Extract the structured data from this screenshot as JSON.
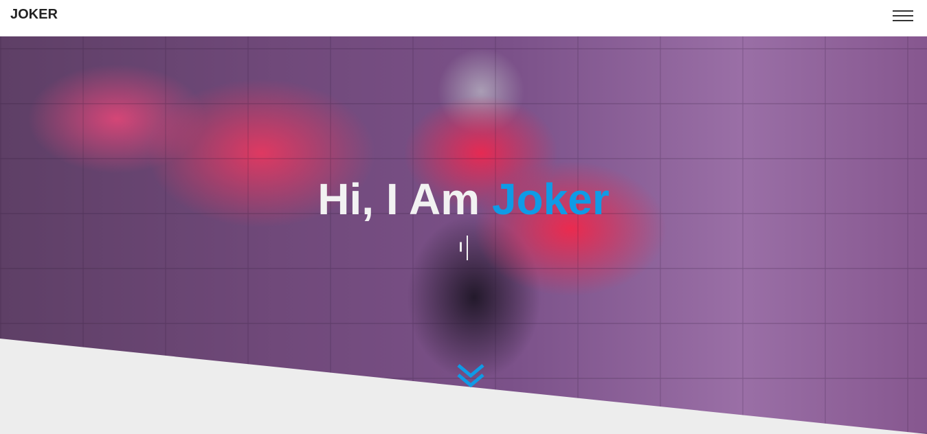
{
  "navbar": {
    "brand": "JOKER",
    "menu_icon": "hamburger-menu-icon"
  },
  "hero": {
    "title_prefix": "Hi, I Am ",
    "title_accent": "Joker",
    "typed_text": "I",
    "scroll_icon": "double-chevron-down-icon"
  },
  "colors": {
    "accent": "#0f9be6",
    "navbar_bg": "#ffffff",
    "page_bg": "#ededed",
    "title_text": "#f2f2f2"
  }
}
